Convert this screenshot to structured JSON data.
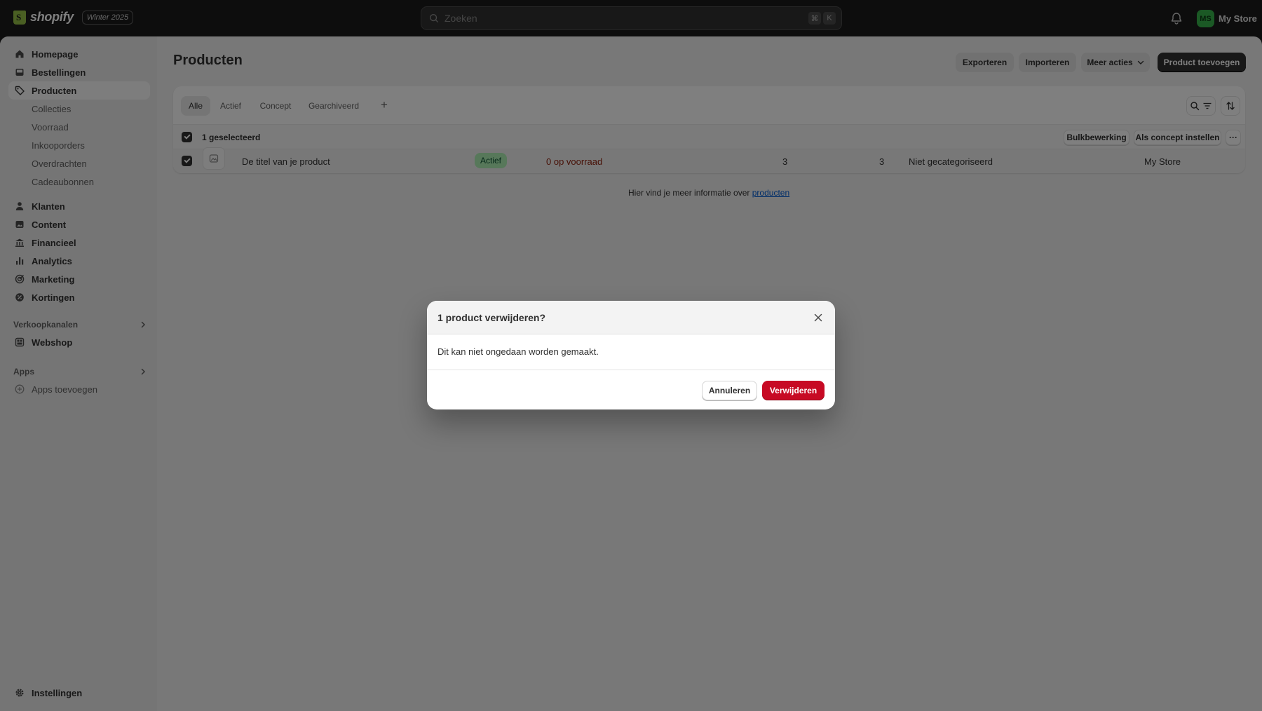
{
  "topbar": {
    "logo_text": "shopify",
    "edition": "Winter 2025",
    "search_placeholder": "Zoeken",
    "shortcut_cmd": "⌘",
    "shortcut_key": "K",
    "avatar_initials": "MS",
    "store_name": "My Store"
  },
  "sidebar": {
    "items": [
      {
        "label": "Homepage",
        "icon": "home-icon"
      },
      {
        "label": "Bestellingen",
        "icon": "inbox-icon"
      },
      {
        "label": "Producten",
        "icon": "tag-icon",
        "active": true
      },
      {
        "label": "Klanten",
        "icon": "person-icon"
      },
      {
        "label": "Content",
        "icon": "content-icon"
      },
      {
        "label": "Financieel",
        "icon": "bank-icon"
      },
      {
        "label": "Analytics",
        "icon": "bar-chart-icon"
      },
      {
        "label": "Marketing",
        "icon": "target-icon"
      },
      {
        "label": "Kortingen",
        "icon": "discount-icon"
      }
    ],
    "sub_items": [
      "Collecties",
      "Voorraad",
      "Inkooporders",
      "Overdrachten",
      "Cadeaubonnen"
    ],
    "sales_channels_label": "Verkoopkanalen",
    "webshop_label": "Webshop",
    "apps_label": "Apps",
    "add_apps_label": "Apps toevoegen",
    "settings_label": "Instellingen"
  },
  "page": {
    "title": "Producten",
    "export_label": "Exporteren",
    "import_label": "Importeren",
    "more_actions_label": "Meer acties",
    "add_product_label": "Product toevoegen"
  },
  "tabs": [
    "Alle",
    "Actief",
    "Concept",
    "Gearchiveerd"
  ],
  "tab_add": "+",
  "bulk": {
    "selected_label": "1 geselecteerd",
    "bulk_edit_label": "Bulkbewerking",
    "set_draft_label": "Als concept instellen",
    "more_label": "···"
  },
  "product_row": {
    "title": "De titel van je product",
    "status": "Actief",
    "inventory": "0 op voorraad",
    "sales_channels": "3",
    "markets": "3",
    "category": "Niet gecategoriseerd",
    "vendor": "My Store"
  },
  "info": {
    "text": "Hier vind je meer informatie over",
    "link": "producten"
  },
  "modal": {
    "title": "1 product verwijderen?",
    "body": "Dit kan niet ongedaan worden gemaakt.",
    "cancel_label": "Annuleren",
    "delete_label": "Verwijderen"
  },
  "colors": {
    "topbar": "#1a1a1a",
    "primary_button": "#303030",
    "danger_button": "#c70a24",
    "active_badge": "#aff0b5",
    "stock_warning": "#8e1f0b",
    "link": "#005bd3"
  }
}
